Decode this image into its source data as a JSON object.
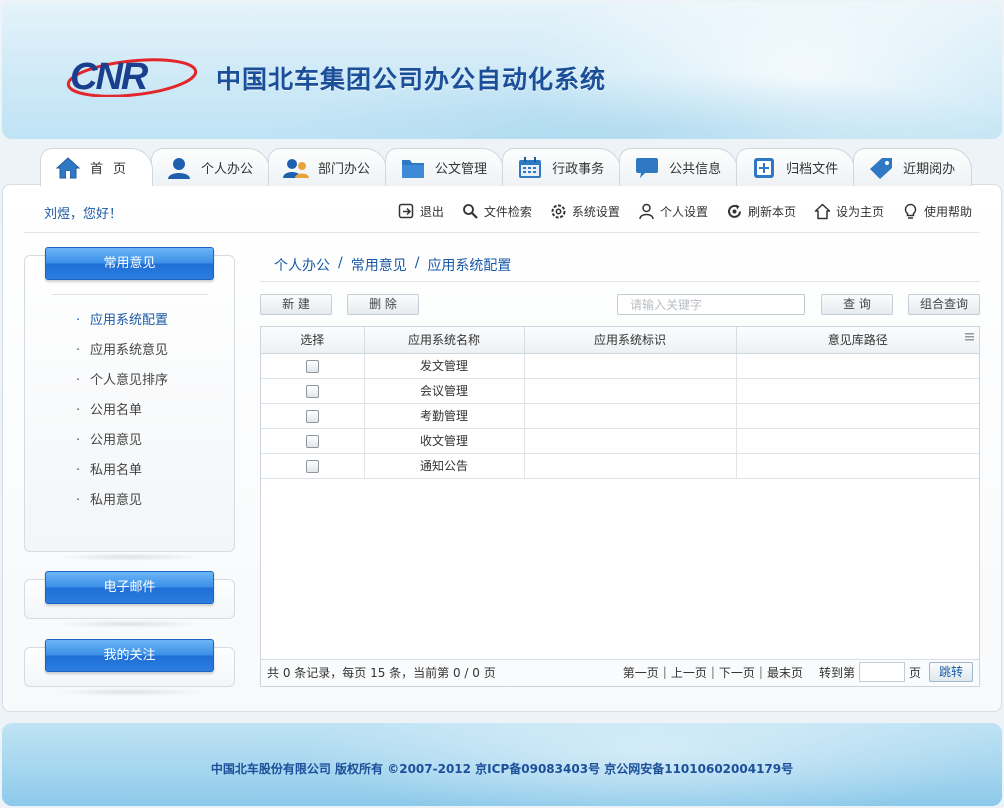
{
  "header": {
    "logo_text": "CNR",
    "system_title": "中国北车集团公司办公自动化系统"
  },
  "tabs": [
    {
      "label": "首页",
      "icon": "home-icon"
    },
    {
      "label": "个人办公",
      "icon": "user-icon"
    },
    {
      "label": "部门办公",
      "icon": "group-icon"
    },
    {
      "label": "公文管理",
      "icon": "folder-icon"
    },
    {
      "label": "行政事务",
      "icon": "calendar-icon"
    },
    {
      "label": "公共信息",
      "icon": "chat-bubble-icon"
    },
    {
      "label": "归档文件",
      "icon": "archive-plus-icon"
    },
    {
      "label": "近期阅办",
      "icon": "tag-icon"
    }
  ],
  "greeting": "刘煜，您好！",
  "toolbar": [
    {
      "label": "退出",
      "icon": "logout-icon"
    },
    {
      "label": "文件检索",
      "icon": "search-icon"
    },
    {
      "label": "系统设置",
      "icon": "gear-icon"
    },
    {
      "label": "个人设置",
      "icon": "person-icon"
    },
    {
      "label": "刷新本页",
      "icon": "refresh-icon"
    },
    {
      "label": "设为主页",
      "icon": "house-outline-icon"
    },
    {
      "label": "使用帮助",
      "icon": "lightbulb-icon"
    }
  ],
  "sidebar": {
    "sections": [
      {
        "title": "常用意见"
      },
      {
        "title": "电子邮件"
      },
      {
        "title": "我的关注"
      }
    ],
    "items": [
      {
        "label": "应用系统配置",
        "active": true
      },
      {
        "label": "应用系统意见"
      },
      {
        "label": "个人意见排序"
      },
      {
        "label": "公用名单"
      },
      {
        "label": "公用意见"
      },
      {
        "label": "私用名单"
      },
      {
        "label": "私用意见"
      }
    ]
  },
  "breadcrumb": [
    "个人办公",
    "常用意见",
    "应用系统配置"
  ],
  "breadcrumb_separator": "/",
  "actions": {
    "new_label": "新 建",
    "delete_label": "删 除",
    "search_placeholder": "请输入关键字",
    "query_label": "查 询",
    "combined_query_label": "组合查询"
  },
  "grid": {
    "columns": [
      "选择",
      "应用系统名称",
      "应用系统标识",
      "意见库路径"
    ],
    "rows": [
      {
        "name": "发文管理",
        "identifier": "",
        "path": ""
      },
      {
        "name": "会议管理",
        "identifier": "",
        "path": ""
      },
      {
        "name": "考勤管理",
        "identifier": "",
        "path": ""
      },
      {
        "name": "收文管理",
        "identifier": "",
        "path": ""
      },
      {
        "name": "通知公告",
        "identifier": "",
        "path": ""
      }
    ]
  },
  "pager": {
    "summary": "共 0 条记录，每页 15 条，当前第 0 / 0 页",
    "first": "第一页",
    "prev": "上一页",
    "next": "下一页",
    "last": "最末页",
    "separator": "|",
    "goto_label": "转到第",
    "page_unit": "页",
    "jump_label": "跳转"
  },
  "footer": {
    "copyright": "中国北车股份有限公司 版权所有 ©2007-2012 京ICP备09083403号 京公网安备11010602004179号"
  },
  "colors": {
    "brand_blue": "#1b4f9a",
    "link_blue": "#1a5aa6",
    "logo_red": "#e2262b"
  }
}
